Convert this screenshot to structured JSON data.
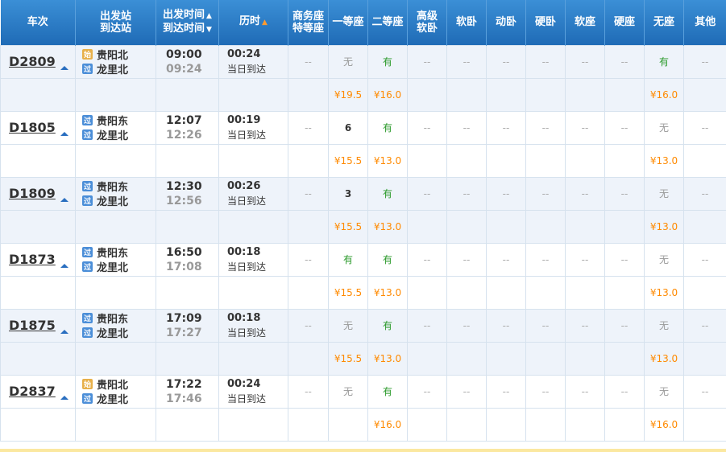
{
  "header": {
    "train": "车次",
    "station_top": "出发站",
    "station_bottom": "到达站",
    "time_top": "出发时间",
    "time_bottom": "到达时间",
    "duration": "历时",
    "business_top": "商务座",
    "business_bottom": "特等座",
    "first": "一等座",
    "second": "二等座",
    "high_soft_top": "高级",
    "high_soft_bottom": "软卧",
    "soft_sleeper": "软卧",
    "bullet_sleeper": "动卧",
    "hard_sleeper": "硬卧",
    "soft_seat": "软座",
    "hard_seat": "硬座",
    "no_seat": "无座",
    "other": "其他"
  },
  "trains": [
    {
      "num": "D2809",
      "from": "贵阳北",
      "from_badge": "始",
      "to": "龙里北",
      "to_badge": "过",
      "dep": "09:00",
      "arr": "09:24",
      "dur": "00:24",
      "note": "当日到达",
      "seats": [
        "--",
        "无",
        "有",
        "--",
        "--",
        "--",
        "--",
        "--",
        "--",
        "有",
        "--"
      ],
      "prices": [
        "",
        "¥19.5",
        "¥16.0",
        "",
        "",
        "",
        "",
        "",
        "",
        "¥16.0",
        ""
      ]
    },
    {
      "num": "D1805",
      "from": "贵阳东",
      "from_badge": "过",
      "to": "龙里北",
      "to_badge": "过",
      "dep": "12:07",
      "arr": "12:26",
      "dur": "00:19",
      "note": "当日到达",
      "seats": [
        "--",
        "6",
        "有",
        "--",
        "--",
        "--",
        "--",
        "--",
        "--",
        "无",
        "--"
      ],
      "prices": [
        "",
        "¥15.5",
        "¥13.0",
        "",
        "",
        "",
        "",
        "",
        "",
        "¥13.0",
        ""
      ]
    },
    {
      "num": "D1809",
      "from": "贵阳东",
      "from_badge": "过",
      "to": "龙里北",
      "to_badge": "过",
      "dep": "12:30",
      "arr": "12:56",
      "dur": "00:26",
      "note": "当日到达",
      "seats": [
        "--",
        "3",
        "有",
        "--",
        "--",
        "--",
        "--",
        "--",
        "--",
        "无",
        "--"
      ],
      "prices": [
        "",
        "¥15.5",
        "¥13.0",
        "",
        "",
        "",
        "",
        "",
        "",
        "¥13.0",
        ""
      ]
    },
    {
      "num": "D1873",
      "from": "贵阳东",
      "from_badge": "过",
      "to": "龙里北",
      "to_badge": "过",
      "dep": "16:50",
      "arr": "17:08",
      "dur": "00:18",
      "note": "当日到达",
      "seats": [
        "--",
        "有",
        "有",
        "--",
        "--",
        "--",
        "--",
        "--",
        "--",
        "无",
        "--"
      ],
      "prices": [
        "",
        "¥15.5",
        "¥13.0",
        "",
        "",
        "",
        "",
        "",
        "",
        "¥13.0",
        ""
      ]
    },
    {
      "num": "D1875",
      "from": "贵阳东",
      "from_badge": "过",
      "to": "龙里北",
      "to_badge": "过",
      "dep": "17:09",
      "arr": "17:27",
      "dur": "00:18",
      "note": "当日到达",
      "seats": [
        "--",
        "无",
        "有",
        "--",
        "--",
        "--",
        "--",
        "--",
        "--",
        "无",
        "--"
      ],
      "prices": [
        "",
        "¥15.5",
        "¥13.0",
        "",
        "",
        "",
        "",
        "",
        "",
        "¥13.0",
        ""
      ]
    },
    {
      "num": "D2837",
      "from": "贵阳北",
      "from_badge": "始",
      "to": "龙里北",
      "to_badge": "过",
      "dep": "17:22",
      "arr": "17:46",
      "dur": "00:24",
      "note": "当日到达",
      "seats": [
        "--",
        "无",
        "有",
        "--",
        "--",
        "--",
        "--",
        "--",
        "--",
        "无",
        "--"
      ],
      "prices": [
        "",
        "",
        "¥16.0",
        "",
        "",
        "",
        "",
        "",
        "",
        "¥16.0",
        ""
      ]
    }
  ],
  "colors": {
    "header_top": "#3b8fd6",
    "header_bottom": "#1f6bb6",
    "have": "#2b9a2b",
    "price": "#ff8a00",
    "row_alt": "#eef3fa"
  }
}
